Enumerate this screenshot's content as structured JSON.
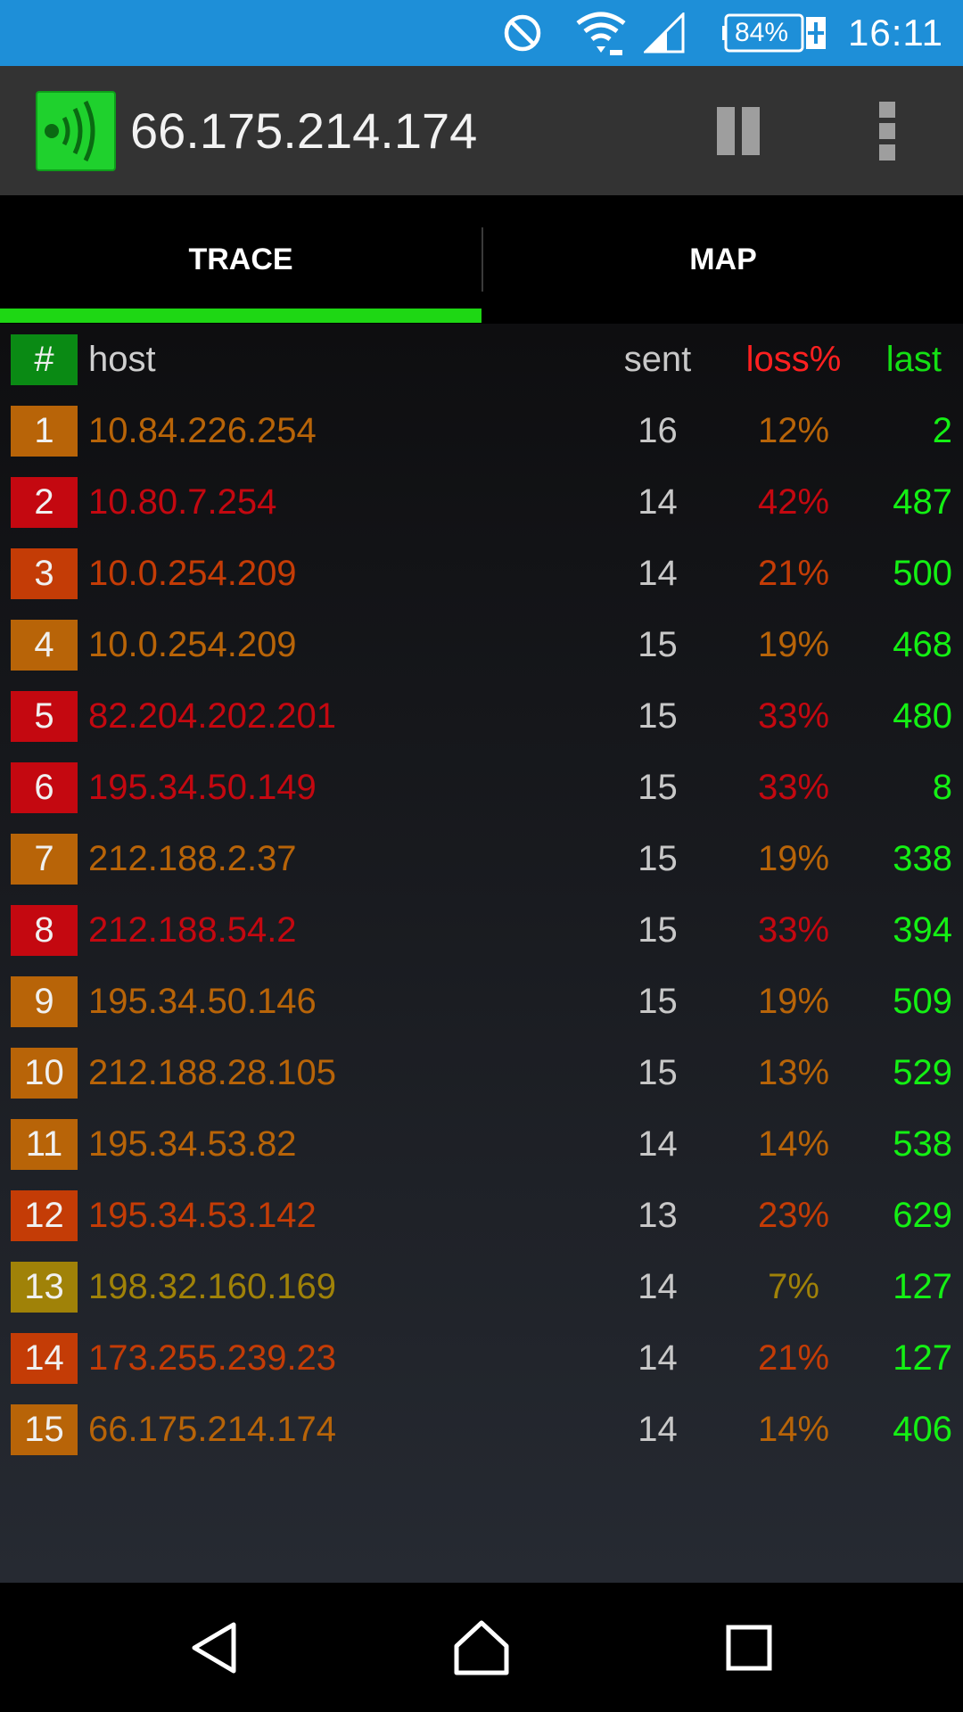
{
  "status_bar": {
    "time": "16:11",
    "battery": "84%",
    "icons": [
      "do-not-disturb-icon",
      "wifi-icon",
      "signal-icon",
      "battery-icon"
    ]
  },
  "app_bar": {
    "title": "66.175.214.174",
    "logo_icon": "app-logo-icon",
    "pause_icon": "pause-icon",
    "menu_icon": "overflow-menu-icon"
  },
  "tabs": [
    {
      "label": "TRACE",
      "active": true
    },
    {
      "label": "MAP",
      "active": false
    }
  ],
  "table": {
    "headers": {
      "num": "#",
      "host": "host",
      "sent": "sent",
      "loss": "loss%",
      "last": "last"
    },
    "rows": [
      {
        "num": "1",
        "host": "10.84.226.254",
        "sent": "16",
        "loss": "12%",
        "last": "2",
        "color": "#b86408"
      },
      {
        "num": "2",
        "host": "10.80.7.254",
        "sent": "14",
        "loss": "42%",
        "last": "487",
        "color": "#c40810"
      },
      {
        "num": "3",
        "host": "10.0.254.209",
        "sent": "14",
        "loss": "21%",
        "last": "500",
        "color": "#c43c06"
      },
      {
        "num": "4",
        "host": "10.0.254.209",
        "sent": "15",
        "loss": "19%",
        "last": "468",
        "color": "#b86408"
      },
      {
        "num": "5",
        "host": "82.204.202.201",
        "sent": "15",
        "loss": "33%",
        "last": "480",
        "color": "#c40810"
      },
      {
        "num": "6",
        "host": "195.34.50.149",
        "sent": "15",
        "loss": "33%",
        "last": "8",
        "color": "#c40810"
      },
      {
        "num": "7",
        "host": "212.188.2.37",
        "sent": "15",
        "loss": "19%",
        "last": "338",
        "color": "#b86408"
      },
      {
        "num": "8",
        "host": "212.188.54.2",
        "sent": "15",
        "loss": "33%",
        "last": "394",
        "color": "#c40810"
      },
      {
        "num": "9",
        "host": "195.34.50.146",
        "sent": "15",
        "loss": "19%",
        "last": "509",
        "color": "#b86408"
      },
      {
        "num": "10",
        "host": "212.188.28.105",
        "sent": "15",
        "loss": "13%",
        "last": "529",
        "color": "#b86408"
      },
      {
        "num": "11",
        "host": "195.34.53.82",
        "sent": "14",
        "loss": "14%",
        "last": "538",
        "color": "#b86408"
      },
      {
        "num": "12",
        "host": "195.34.53.142",
        "sent": "13",
        "loss": "23%",
        "last": "629",
        "color": "#c43c06"
      },
      {
        "num": "13",
        "host": "198.32.160.169",
        "sent": "14",
        "loss": "7%",
        "last": "127",
        "color": "#a08208"
      },
      {
        "num": "14",
        "host": "173.255.239.23",
        "sent": "14",
        "loss": "21%",
        "last": "127",
        "color": "#c43c06"
      },
      {
        "num": "15",
        "host": "66.175.214.174",
        "sent": "14",
        "loss": "14%",
        "last": "406",
        "color": "#b86408"
      }
    ]
  },
  "colors": {
    "status_bar": "#1e8fd8",
    "app_bar": "#333333",
    "accent_green": "#1ed714",
    "header_num_bg": "#0a8a14",
    "loss_header": "#ff2020",
    "last_value": "#14f014"
  },
  "nav_bar": {
    "icons": [
      "back-icon",
      "home-icon",
      "recents-icon"
    ]
  }
}
